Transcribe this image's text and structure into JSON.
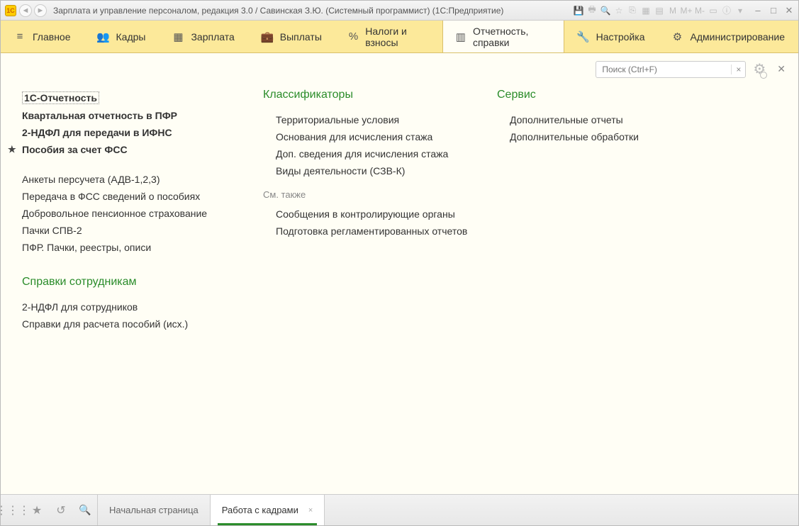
{
  "window": {
    "title": "Зарплата и управление персоналом, редакция 3.0 / Савинская З.Ю. (Системный программист)  (1С:Предприятие)",
    "logo_text": "1C",
    "calc_m": "M",
    "calc_mplus": "M+",
    "calc_mminus": "M-"
  },
  "nav": {
    "items": [
      {
        "icon": "menu",
        "label": "Главное"
      },
      {
        "icon": "people",
        "label": "Кадры"
      },
      {
        "icon": "calc",
        "label": "Зарплата"
      },
      {
        "icon": "wallet",
        "label": "Выплаты"
      },
      {
        "icon": "percent",
        "label": "Налоги и взносы"
      },
      {
        "icon": "report",
        "label": "Отчетность, справки"
      },
      {
        "icon": "wrench",
        "label": "Настройка"
      },
      {
        "icon": "gear",
        "label": "Администрирование"
      }
    ],
    "active_index": 5
  },
  "search": {
    "placeholder": "Поиск (Ctrl+F)"
  },
  "col1": {
    "primary": [
      {
        "label": "1С-Отчетность",
        "bold": true,
        "favorite": false,
        "selected": true
      },
      {
        "label": "Квартальная отчетность в ПФР",
        "bold": true,
        "favorite": false
      },
      {
        "label": "2-НДФЛ для передачи в ИФНС",
        "bold": true,
        "favorite": false
      },
      {
        "label": "Пособия за счет ФСС",
        "bold": true,
        "favorite": true
      }
    ],
    "secondary": [
      {
        "label": "Анкеты персучета (АДВ-1,2,3)"
      },
      {
        "label": "Передача в ФСС сведений о пособиях"
      },
      {
        "label": "Добровольное пенсионное страхование"
      },
      {
        "label": "Пачки СПВ-2"
      },
      {
        "label": "ПФР. Пачки, реестры, описи"
      }
    ],
    "section2_title": "Справки сотрудникам",
    "section2_items": [
      {
        "label": "2-НДФЛ для сотрудников"
      },
      {
        "label": "Справки для расчета пособий (исх.)"
      }
    ]
  },
  "col2": {
    "section_title": "Классификаторы",
    "items": [
      {
        "label": "Территориальные условия"
      },
      {
        "label": "Основания для исчисления стажа"
      },
      {
        "label": "Доп. сведения для исчисления стажа"
      },
      {
        "label": "Виды деятельности (СЗВ-К)"
      }
    ],
    "see_also_label": "См. также",
    "see_also_items": [
      {
        "label": "Сообщения в контролирующие органы"
      },
      {
        "label": "Подготовка регламентированных отчетов"
      }
    ]
  },
  "col3": {
    "section_title": "Сервис",
    "items": [
      {
        "label": "Дополнительные отчеты"
      },
      {
        "label": "Дополнительные обработки"
      }
    ]
  },
  "bottom": {
    "tabs": [
      {
        "label": "Начальная страница",
        "closable": false,
        "active": false
      },
      {
        "label": "Работа с кадрами",
        "closable": true,
        "active": true
      }
    ]
  }
}
